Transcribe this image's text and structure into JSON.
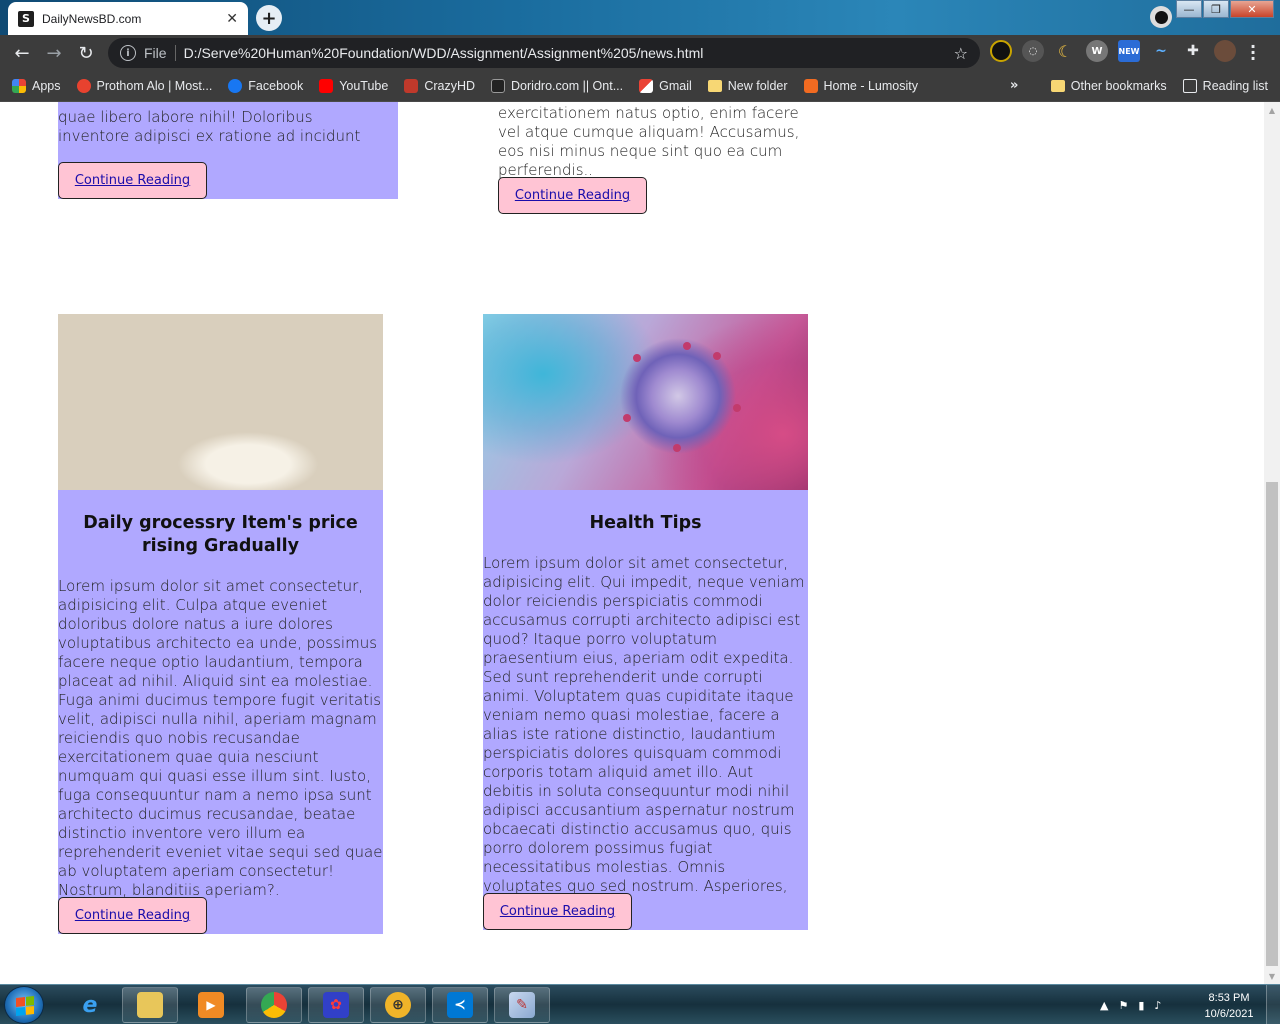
{
  "browser": {
    "tab_title": "DailyNewsBD.com",
    "url_scheme": "File",
    "url": "D:/Serve%20Human%20Foundation/WDD/Assignment/Assignment%205/news.html",
    "bookmarks": [
      {
        "label": "Apps",
        "color": "#e24b4b"
      },
      {
        "label": "Prothom Alo | Most...",
        "color": "#e8422f"
      },
      {
        "label": "Facebook",
        "color": "#1877f2"
      },
      {
        "label": "YouTube",
        "color": "#ff0000"
      },
      {
        "label": "CrazyHD",
        "color": "#c0392b"
      },
      {
        "label": "Doridro.com || Ont...",
        "color": "#222222"
      },
      {
        "label": "Gmail",
        "color": "#ea4335"
      },
      {
        "label": "New folder",
        "color": "#f7d774"
      },
      {
        "label": "Home - Lumosity",
        "color": "#f26b21"
      }
    ],
    "other_bookmarks": "Other bookmarks",
    "reading_list": "Reading list",
    "ext_badge": "NEW"
  },
  "page": {
    "top_cards": [
      {
        "text": "quae libero labore nihil! Doloribus inventore adipisci ex ratione ad incidunt",
        "cta": "Continue Reading"
      },
      {
        "text": "exercitationem natus optio, enim facere vel atque cumque aliquam! Accusamus, eos nisi minus neque sint quo ea cum perferendis..",
        "cta": "Continue Reading"
      }
    ],
    "cards": [
      {
        "image": "spice-market-photo",
        "title": "Daily grocessry Item's price rising Gradually",
        "text": "Lorem ipsum dolor sit amet consectetur, adipisicing elit. Culpa atque eveniet doloribus dolore natus a iure dolores voluptatibus architecto ea unde, possimus facere neque optio laudantium, tempora placeat ad nihil. Aliquid sint ea molestiae. Fuga animi ducimus tempore fugit veritatis velit, adipisci nulla nihil, aperiam magnam reiciendis quo nobis recusandae exercitationem quae quia nesciunt numquam qui quasi esse illum sint. Iusto, fuga consequuntur nam a nemo ipsa sunt architecto ducimus recusandae, beatae distinctio inventore vero illum ea reprehenderit eveniet vitae sequi sed quae ab voluptatem aperiam consectetur! Nostrum, blanditiis aperiam?.",
        "cta": "Continue Reading"
      },
      {
        "image": "coronavirus-illustration",
        "title": "Health Tips",
        "text": "Lorem ipsum dolor sit amet consectetur, adipisicing elit. Qui impedit, neque veniam dolor reiciendis perspiciatis commodi accusamus corrupti architecto adipisci est quod? Itaque porro voluptatum praesentium eius, aperiam odit expedita. Sed sunt reprehenderit unde corrupti animi. Voluptatem quas cupiditate itaque veniam nemo quasi molestiae, facere a alias iste ratione distinctio, laudantium perspiciatis dolores quisquam commodi corporis totam aliquid amet illo. Aut debitis in soluta consequuntur modi nihil adipisci accusantium aspernatur nostrum obcaecati distinctio accusamus quo, quis porro dolorem possimus fugiat necessitatibus molestias. Omnis voluptates quo sed nostrum. Asperiores, sunt iusto.",
        "cta": "Continue Reading"
      }
    ],
    "card_color": "#b0a8ff",
    "button_color": "#ffc4d4"
  },
  "taskbar": {
    "time": "8:53 PM",
    "date": "10/6/2021"
  }
}
